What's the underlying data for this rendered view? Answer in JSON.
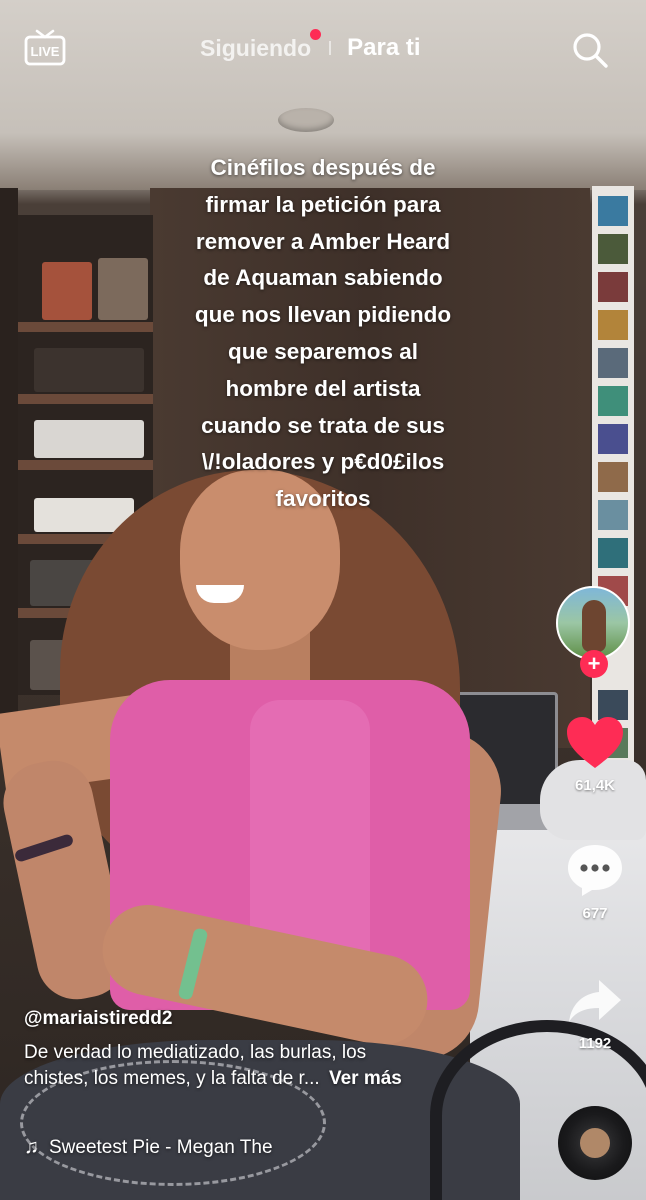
{
  "top_nav": {
    "live_label": "LIVE",
    "tab_following": "Siguiendo",
    "tab_for_you": "Para ti",
    "active_tab": "Para ti"
  },
  "video": {
    "caption_lines": [
      "Cinéfilos después de",
      "firmar la petición para",
      "remover a Amber Heard",
      "de Aquaman sabiendo",
      "que nos llevan pidiendo",
      "que separemos al",
      "hombre del artista",
      "cuando se trata de sus",
      "\\/!oladores y p€d0£ilos",
      "favoritos"
    ]
  },
  "actions": {
    "likes": "61,4K",
    "comments": "677",
    "shares": "1192",
    "like_color": "#fe2c55",
    "follow_color": "#fe2c55"
  },
  "post": {
    "username": "@mariaistiredd2",
    "description_line1": "De verdad lo mediatizado, las burlas, los",
    "description_line2": "chistes, los memes, y la falta de r...",
    "see_more": "Ver más",
    "music": "Sweetest Pie - Megan The"
  },
  "icons": {
    "live": "live-tv-icon",
    "search": "search-icon",
    "like": "heart-icon",
    "comment": "comment-icon",
    "share": "share-icon",
    "music": "music-note-icon"
  }
}
